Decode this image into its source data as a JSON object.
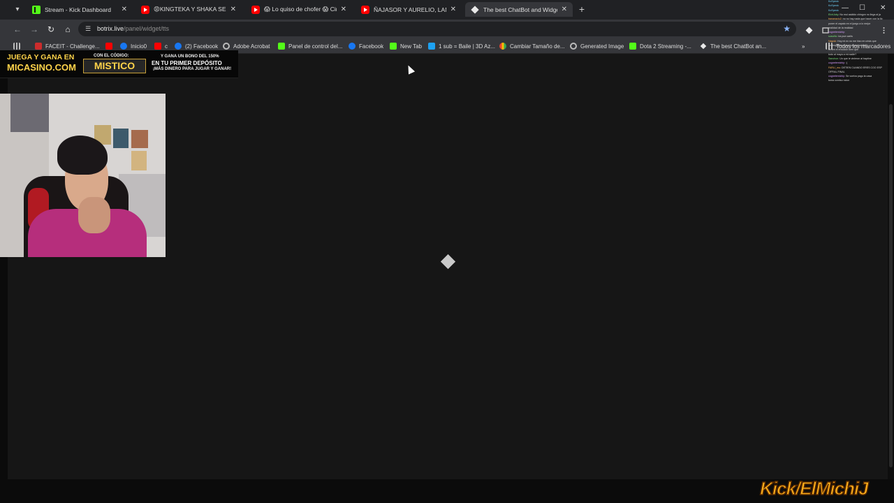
{
  "tabs": [
    {
      "label": "Stream - Kick Dashboard",
      "favicon": "kick-icon",
      "active": false
    },
    {
      "label": "😡KINGTEKA Y SHAKA SE TIRAN",
      "favicon": "youtube-icon",
      "active": false
    },
    {
      "label": "😱 Lo quiso de chofer 😱 Cirilo",
      "favicon": "youtube-icon",
      "active": false
    },
    {
      "label": "ÑAJASOR Y AURELIO, LANZAN",
      "favicon": "youtube-icon",
      "active": false
    },
    {
      "label": "The best ChatBot and Widgets f",
      "favicon": "botrix-icon",
      "active": true
    }
  ],
  "address": {
    "host": "botrix.live",
    "path": "/panel/widget/tts"
  },
  "bookmarks": [
    {
      "label": "FACEIT - Challenge..."
    },
    {
      "label": ""
    },
    {
      "label": "Inicio0"
    },
    {
      "label": "c"
    },
    {
      "label": "(2) Facebook"
    },
    {
      "label": "Adobe Acrobat"
    },
    {
      "label": "Panel de control del..."
    },
    {
      "label": "Facebook"
    },
    {
      "label": "New Tab"
    },
    {
      "label": "1 sub = Baile | 3D Az..."
    },
    {
      "label": "Cambiar Tamaño de..."
    },
    {
      "label": "Generated Image"
    },
    {
      "label": "Dota 2 Streaming -..."
    },
    {
      "label": "The best ChatBot an..."
    }
  ],
  "bookmarks_more": "»",
  "all_bookmarks": "Todos los marcadores",
  "banner": {
    "line1": "JUEGA Y GANA EN",
    "brand": "MICASINO.COM",
    "code_label": "CON EL CÓDIGO:",
    "code": "MISTICO",
    "promo1": "Y GANA UN BONO DEL 150%",
    "promo2": "EN TU PRIMER DEPÓSITO",
    "promo3": "¡MÁS DINERO PARA JUGAR Y GANAR!"
  },
  "chat": [
    {
      "user": "KoSpeck:",
      "text": "",
      "color": "b"
    },
    {
      "user": "KoSpeck:",
      "text": "",
      "color": "b"
    },
    {
      "user": "KoSpeck:",
      "text": "",
      "color": "b"
    },
    {
      "user": "ElchJoky:",
      "text": "No mul asidido chingon no llega al ja",
      "color": "g"
    },
    {
      "user": "bananaclu2:",
      "text": "no no hay nada que hacer con la llo",
      "color": "o"
    },
    {
      "user": "",
      "text": "poner el zapato en el juego a lo mejor",
      "color": "b"
    },
    {
      "user": "",
      "text": "realidad de la realidad",
      "color": "b"
    },
    {
      "user": "cognetemichiy:",
      "text": "",
      "color": "p"
    },
    {
      "user": "suscrito:",
      "text": "ira pue cariis",
      "color": "g"
    },
    {
      "user": "Nayuki:",
      "text": "Hoy mi ex no me hizo en crisis que",
      "color": "o"
    },
    {
      "user": "",
      "text": "un programa a que ya que pal 8v8",
      "color": "b"
    },
    {
      "user": "",
      "text": "tienen el emocion bien que",
      "color": "b"
    },
    {
      "user": "",
      "text": "todo al maya a mi nadie?",
      "color": "b"
    },
    {
      "user": "Sanchon:",
      "text": "Un que le vinieron al baptine",
      "color": "g"
    },
    {
      "user": "cognetemichiy:",
      "text": ":(",
      "color": "p"
    },
    {
      "user": "FARLI_mu:",
      "text": "DETIEN CUANDO ERES COO ESP",
      "color": "o"
    },
    {
      "user": "",
      "text": "OFFIAL FINAL",
      "color": "b"
    },
    {
      "user": "cognetemichiy:",
      "text": "Se vuelva pagu la casa",
      "color": "p"
    },
    {
      "user": "",
      "text": "toma conriso ncion",
      "color": "b"
    }
  ],
  "watermark": "Kick/ElMichiJ",
  "colors": {
    "accent": "#53fc18",
    "page_bg": "#161616",
    "banner_gold": "#ffd34a"
  }
}
